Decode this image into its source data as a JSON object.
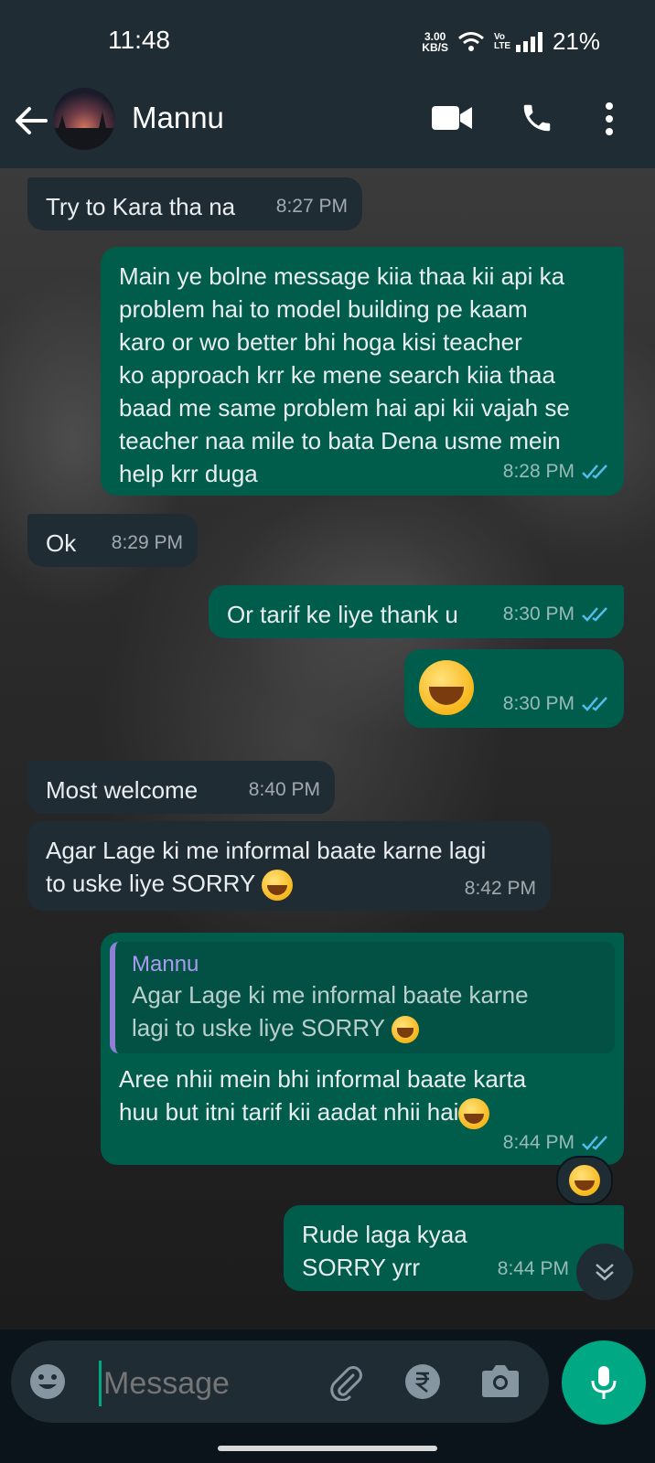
{
  "status_bar": {
    "time": "11:48",
    "speed_value": "3.00",
    "speed_unit": "KB/S",
    "network": "Vo LTE",
    "battery": "21%"
  },
  "header": {
    "contact_name": "Mannu",
    "icons": [
      "back-arrow-icon",
      "video-call-icon",
      "voice-call-icon",
      "more-options-icon"
    ]
  },
  "messages": [
    {
      "direction": "in",
      "text": "Try to Kara tha na",
      "time": "8:27 PM"
    },
    {
      "direction": "out",
      "lines": [
        "Main ye bolne message kiia thaa kii api ka",
        "problem hai to model building pe kaam",
        "karo or wo better bhi hoga kisi teacher",
        "ko approach krr ke mene search kiia thaa",
        "baad me same problem hai api kii vajah se",
        "teacher naa mile to bata Dena usme mein",
        "help krr duga"
      ],
      "time": "8:28 PM"
    },
    {
      "direction": "in",
      "text": "Ok",
      "time": "8:29 PM"
    },
    {
      "direction": "out",
      "text": "Or tarif ke liye thank u",
      "time": "8:30 PM"
    },
    {
      "direction": "out",
      "emoji": "sweat-smile-emoji",
      "time": "8:30 PM"
    },
    {
      "direction": "in",
      "text": "Most welcome",
      "time": "8:40 PM"
    },
    {
      "direction": "in",
      "lines": [
        "Agar Lage ki me informal baate karne lagi",
        "to uske liye SORRY"
      ],
      "time": "8:42 PM"
    },
    {
      "direction": "out",
      "quote": {
        "name": "Mannu",
        "lines": [
          "Agar Lage ki me informal baate karne",
          "lagi to uske liye SORRY"
        ]
      },
      "lines": [
        "Aree nhii mein bhi informal baate karta",
        "huu but itni tarif kii aadat nhii hai"
      ],
      "time": "8:44 PM",
      "reaction": "joy-emoji"
    },
    {
      "direction": "out",
      "lines": [
        "Rude laga kyaa",
        "SORRY yrr"
      ],
      "time": "8:44 PM"
    }
  ],
  "composer": {
    "placeholder": "Message",
    "icons": [
      "emoji-icon",
      "attach-icon",
      "rupee-payment-icon",
      "camera-icon",
      "mic-icon"
    ]
  },
  "colors": {
    "header_bg": "#1f2c34",
    "incoming_bubble": "#1f2c34",
    "outgoing_bubble": "#005c4b",
    "accent": "#00a884",
    "read_tick": "#53bdeb"
  }
}
